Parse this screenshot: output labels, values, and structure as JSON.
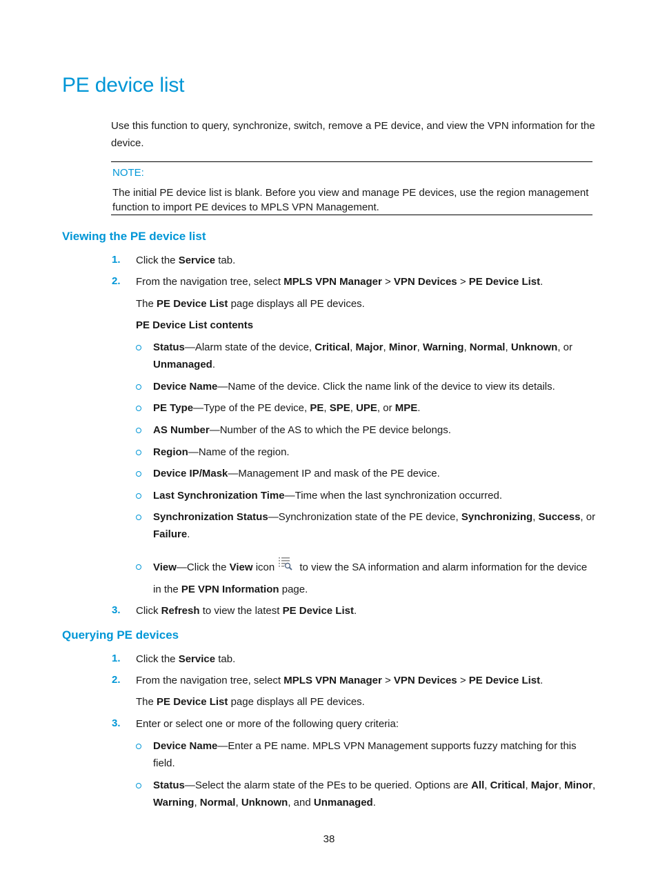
{
  "page": {
    "title": "PE device list",
    "intro": "Use this function to query, synchronize, switch, remove a PE device, and view the VPN information for the device.",
    "note": {
      "label": "NOTE:",
      "text": "The initial PE device list is blank. Before you view and manage PE devices, use the region management function to import PE devices to MPLS VPN Management."
    },
    "page_number": "38",
    "accent_color": "#0096d6"
  },
  "viewing": {
    "heading": "Viewing the PE device list",
    "steps": [
      {
        "num": "1.",
        "pre": "Click the ",
        "b1": "Service",
        "post": " tab."
      },
      {
        "num": "2.",
        "pre": "From the navigation tree, select ",
        "b1": "MPLS VPN Manager",
        "sep1": " > ",
        "b2": "VPN Devices",
        "sep2": " > ",
        "b3": "PE Device List",
        "post": "."
      },
      {
        "num": "3.",
        "pre": "Click ",
        "b1": "Refresh",
        "mid": " to view the latest ",
        "b2": "PE Device List",
        "post": "."
      }
    ],
    "step2_sub": {
      "pre": "The ",
      "b1": "PE Device List",
      "post": " page displays all PE devices."
    },
    "contents_heading": "PE Device List contents",
    "items": [
      {
        "term": "Status",
        "desc": "—Alarm state of the device, ",
        "values": [
          "Critical",
          "Major",
          "Minor",
          "Warning",
          "Normal",
          "Unknown",
          "Unmanaged"
        ],
        "conj": "or"
      },
      {
        "term": "Device Name",
        "desc": "—Name of the device. Click the name link of the device to view its details."
      },
      {
        "term": "PE Type",
        "desc": "—Type of the PE device, ",
        "values": [
          "PE",
          "SPE",
          "UPE",
          "MPE"
        ],
        "conj": "or"
      },
      {
        "term": "AS Number",
        "desc": "—Number of the AS to which the PE device belongs."
      },
      {
        "term": "Region",
        "desc": "—Name of the region."
      },
      {
        "term": "Device IP/Mask",
        "desc": "—Management IP and mask of the PE device."
      },
      {
        "term": "Last Synchronization Time",
        "desc": "—Time when the last synchronization occurred."
      },
      {
        "term": "Synchronization Status",
        "desc": "—Synchronization state of the PE device, ",
        "values": [
          "Synchronizing",
          "Success",
          "Failure"
        ],
        "conj": "or"
      },
      {
        "term": "View",
        "desc_pre": "—Click the ",
        "b_view": "View",
        "desc_mid": " icon",
        "icon": "view-list-search-icon",
        "desc_post": " to view the SA information and alarm information for the device",
        "line2_pre": "in the ",
        "line2_b": "PE VPN Information",
        "line2_post": " page."
      }
    ]
  },
  "querying": {
    "heading": "Querying PE devices",
    "steps": [
      {
        "num": "1.",
        "pre": "Click the ",
        "b1": "Service",
        "post": " tab."
      },
      {
        "num": "2.",
        "pre": "From the navigation tree, select ",
        "b1": "MPLS VPN Manager",
        "sep1": " > ",
        "b2": "VPN Devices",
        "sep2": " > ",
        "b3": "PE Device List",
        "post": "."
      },
      {
        "num": "3.",
        "text": "Enter or select one or more of the following query criteria:"
      }
    ],
    "step2_sub": {
      "pre": "The ",
      "b1": "PE Device List",
      "post": " page displays all PE devices."
    },
    "items": [
      {
        "term": "Device Name",
        "desc": "—Enter a PE name. MPLS VPN Management supports fuzzy matching for this field."
      },
      {
        "term": "Status",
        "desc": "—Select the alarm state of the PEs to be queried. Options are ",
        "values": [
          "All",
          "Critical",
          "Major",
          "Minor",
          "Warning",
          "Normal",
          "Unknown",
          "Unmanaged"
        ],
        "conj": "and"
      }
    ]
  }
}
